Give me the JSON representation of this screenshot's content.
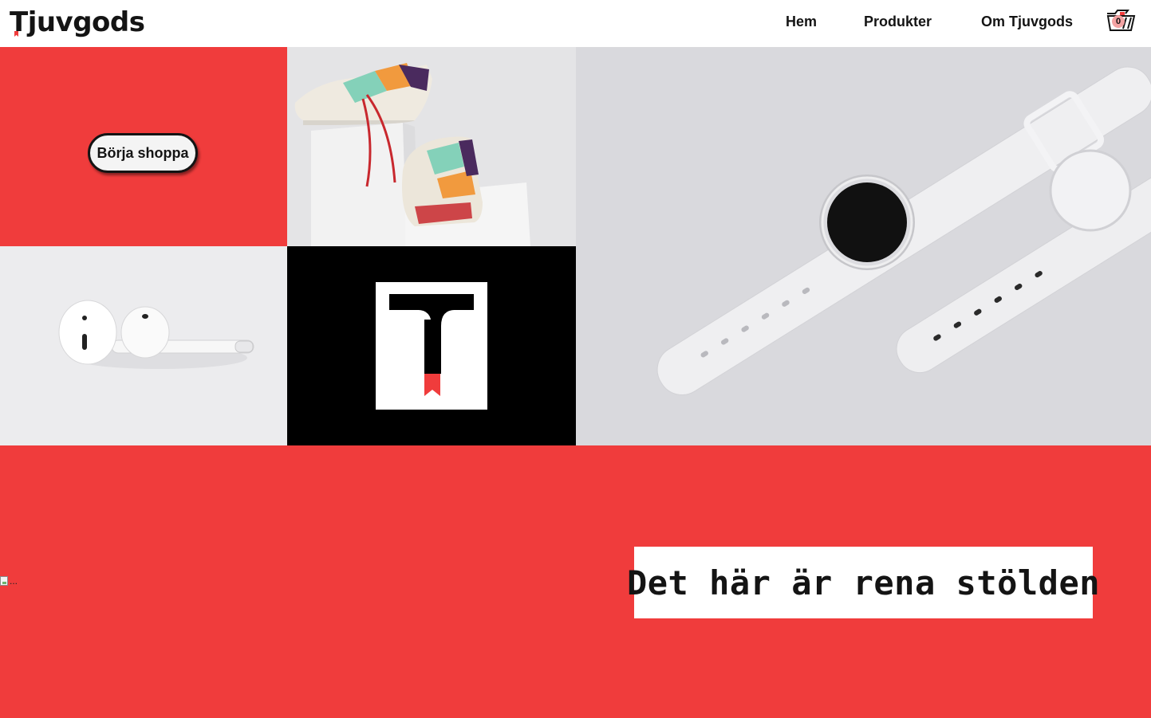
{
  "header": {
    "logo_text": "Tjuvgods",
    "nav": [
      {
        "label": "Hem"
      },
      {
        "label": "Produkter"
      },
      {
        "label": "Om Tjuvgods"
      }
    ],
    "cart_count": "0"
  },
  "hero": {
    "cta_label": "Börja shoppa",
    "tiles": [
      {
        "image": "sneakers-photo"
      },
      {
        "image": "earbuds-photo"
      },
      {
        "image": "tjuvgods-t-logo"
      },
      {
        "image": "smartwatches-photo"
      }
    ]
  },
  "banner": {
    "broken_image_alt": "...",
    "tagline": "Det här är rena stölden"
  },
  "colors": {
    "brand_red": "#f03c3c",
    "text_dark": "#141414",
    "white": "#ffffff",
    "black": "#000000"
  }
}
